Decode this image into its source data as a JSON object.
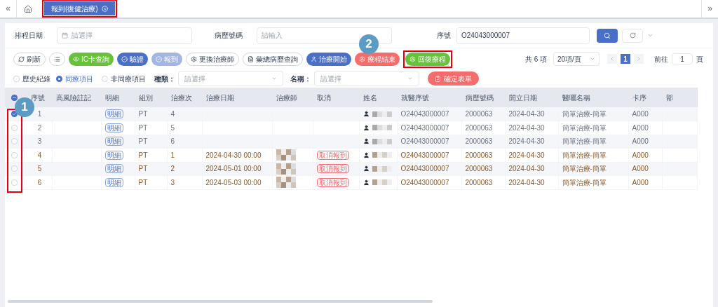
{
  "nav": {
    "back": "«",
    "forward": "»"
  },
  "tabs": [
    {
      "label": "報到(復健治療)",
      "selected": true
    }
  ],
  "filters": [
    {
      "label": "排程日期",
      "placeholder": "請選擇",
      "kind": "date"
    },
    {
      "label": "病歷號碼",
      "placeholder": "請輸入",
      "kind": "text"
    },
    {
      "label": "序號",
      "value": "O24043000007",
      "kind": "text"
    }
  ],
  "toolbar": [
    {
      "label": "刷新",
      "kind": "plain"
    },
    {
      "kind": "plain"
    },
    {
      "label": "IC卡查詢",
      "kind": "green"
    },
    {
      "label": "驗證",
      "kind": "blue"
    },
    {
      "label": "報到",
      "kind": "blue",
      "disabled": true
    },
    {
      "label": "更換治療師",
      "kind": "plain"
    },
    {
      "label": "彙總病歷查詢",
      "kind": "plain"
    },
    {
      "label": "治療開始",
      "kind": "blue"
    },
    {
      "label": "療程結束",
      "kind": "red"
    },
    {
      "label": "回復療程",
      "kind": "green"
    }
  ],
  "pagination": {
    "total": "共 6 項",
    "page_size": "20項/頁",
    "pages": [
      {
        "label": "1",
        "selected": true
      }
    ],
    "goto_label": "前往",
    "goto_value": "1",
    "goto_suffix": "頁"
  },
  "options": {
    "history": {
      "label": "歷史紀錄",
      "checked": false
    },
    "radios": [
      {
        "label": "同療項目",
        "selected": true
      },
      {
        "label": "非同療項目",
        "selected": false
      }
    ],
    "type_label": "種類：",
    "type_placeholder": "請選擇",
    "name_label": "名稱：",
    "name_placeholder": "請選擇",
    "confirm": "確定表單"
  },
  "table": {
    "select_all": {
      "indeterminate": true
    },
    "columns": [
      "序號",
      "高風險註記",
      "明細",
      "組別",
      "治療次",
      "治療日期",
      "治療師",
      "取消",
      "姓名",
      "就醫序號",
      "病歷號碼",
      "開立日期",
      "醫囑名稱",
      "卡序",
      "部"
    ],
    "rows": [
      {
        "checked": true,
        "reported": false,
        "no": "1",
        "detail": "明細",
        "group": "PT",
        "count": "4",
        "visit": "O24043000007",
        "chart": "2000063",
        "opened": "2024-04-30",
        "order": "簡單治療-簡單",
        "card": "A000"
      },
      {
        "checked": false,
        "reported": false,
        "no": "2",
        "detail": "明細",
        "group": "PT",
        "count": "5",
        "visit": "O24043000007",
        "chart": "2000063",
        "opened": "2024-04-30",
        "order": "簡單治療-簡單",
        "card": "A000"
      },
      {
        "checked": false,
        "reported": false,
        "no": "3",
        "detail": "明細",
        "group": "PT",
        "count": "6",
        "visit": "O24043000007",
        "chart": "2000063",
        "opened": "2024-04-30",
        "order": "簡單治療-簡單",
        "card": "A000"
      },
      {
        "checked": false,
        "reported": true,
        "no": "4",
        "detail": "明細",
        "group": "PT",
        "count": "1",
        "date": "2024-04-30 00:00",
        "cancel": "取消報到",
        "visit": "O24043000007",
        "chart": "2000063",
        "opened": "2024-04-30",
        "order": "簡單治療-簡單",
        "card": "A000"
      },
      {
        "checked": false,
        "reported": true,
        "no": "5",
        "detail": "明細",
        "group": "PT",
        "count": "2",
        "date": "2024-05-01 00:00",
        "cancel": "取消報到",
        "visit": "O24043000007",
        "chart": "2000063",
        "opened": "2024-04-30",
        "order": "簡單治療-簡單",
        "card": "A000"
      },
      {
        "checked": false,
        "reported": true,
        "no": "6",
        "detail": "明細",
        "group": "PT",
        "count": "3",
        "date": "2024-05-03 00:00",
        "cancel": "取消報到",
        "visit": "O24043000007",
        "chart": "2000063",
        "opened": "2024-04-30",
        "order": "簡單治療-簡單",
        "card": "A000"
      }
    ]
  },
  "annotations": [
    "1",
    "2"
  ]
}
